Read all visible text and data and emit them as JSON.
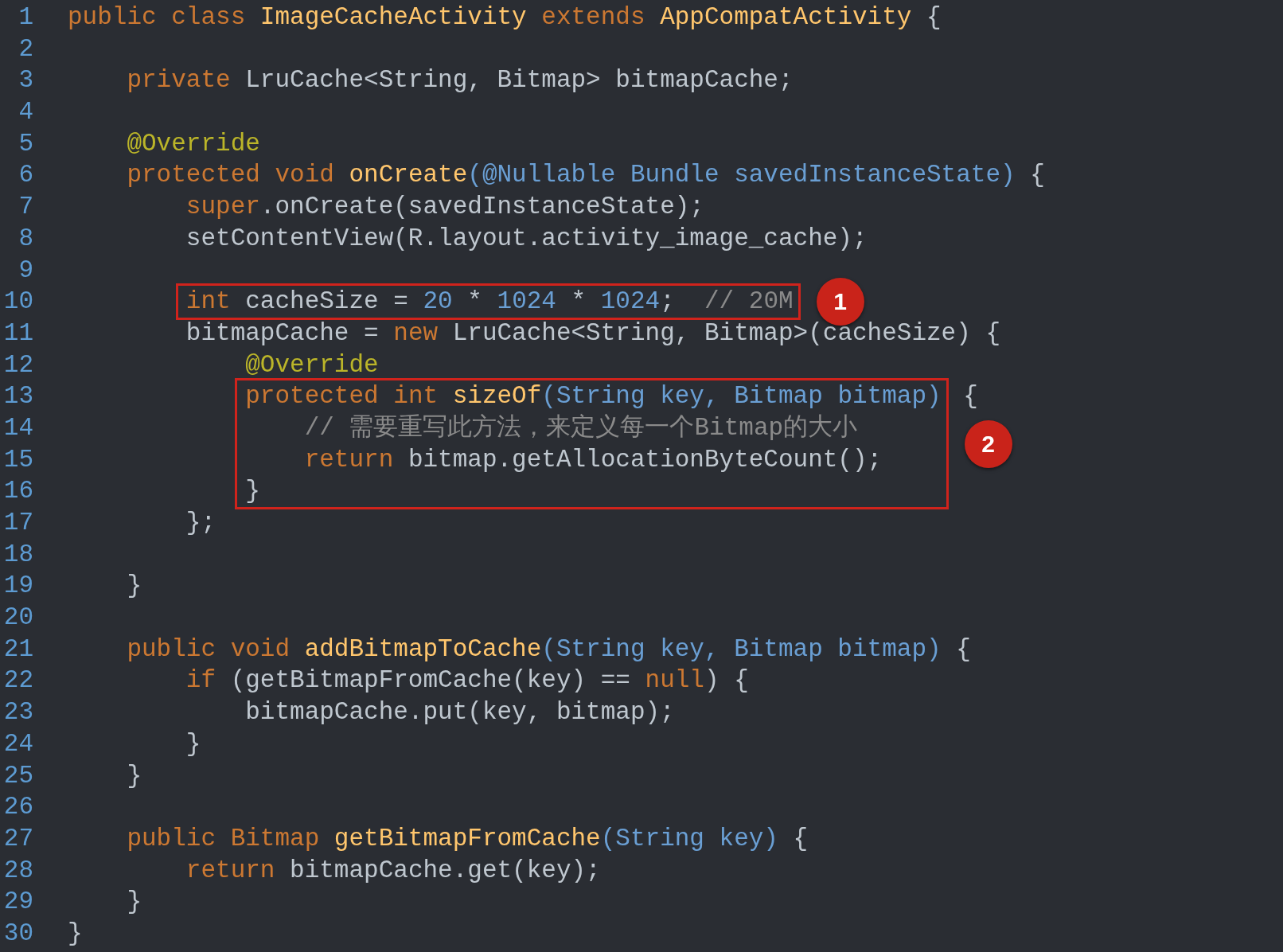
{
  "sections": [
    {
      "kind": "line",
      "number": "1",
      "tokens": [
        {
          "text": "public class ",
          "kind": "keyword"
        },
        {
          "text": "ImageCacheActivity",
          "kind": "method"
        },
        {
          "text": " extends ",
          "kind": "keyword"
        },
        {
          "text": "AppCompatActivity",
          "kind": "method"
        },
        {
          "text": " {",
          "kind": "plain"
        }
      ]
    },
    {
      "kind": "line",
      "number": "2"
    },
    {
      "kind": "line",
      "number": "3",
      "tokens": [
        {
          "text": "    private ",
          "kind": "keyword"
        },
        {
          "text": "LruCache<String, Bitmap> bitmapCache;",
          "kind": "plain"
        }
      ]
    },
    {
      "kind": "line",
      "number": "4"
    },
    {
      "kind": "line",
      "number": "5",
      "tokens": [
        {
          "text": "    @Override",
          "kind": "annotation"
        }
      ]
    },
    {
      "kind": "line",
      "number": "6",
      "tokens": [
        {
          "text": "    protected void ",
          "kind": "keyword"
        },
        {
          "text": "onCreate",
          "kind": "method"
        },
        {
          "text": "(@Nullable Bundle savedInstanceState)",
          "kind": "param"
        },
        {
          "text": " {",
          "kind": "plain"
        }
      ]
    },
    {
      "kind": "line",
      "number": "7",
      "tokens": [
        {
          "text": "        super",
          "kind": "keyword"
        },
        {
          "text": ".onCreate(savedInstanceState);",
          "kind": "plain"
        }
      ]
    },
    {
      "kind": "line",
      "number": "8",
      "tokens": [
        {
          "text": "        setContentView(R.layout.activity_image_cache);",
          "kind": "plain"
        }
      ]
    },
    {
      "kind": "line",
      "number": "9"
    },
    {
      "kind": "callout",
      "badge": "1",
      "lines": [
        {
          "number": "10",
          "tokens": [
            {
              "text": "        int ",
              "kind": "keyword"
            },
            {
              "text": "cacheSize = ",
              "kind": "plain"
            },
            {
              "text": "20",
              "kind": "number"
            },
            {
              "text": " * ",
              "kind": "plain"
            },
            {
              "text": "1024",
              "kind": "number"
            },
            {
              "text": " * ",
              "kind": "plain"
            },
            {
              "text": "1024",
              "kind": "number"
            },
            {
              "text": ";  ",
              "kind": "plain"
            },
            {
              "text": "// 20M",
              "kind": "comment"
            }
          ]
        }
      ]
    },
    {
      "kind": "line",
      "number": "11",
      "tokens": [
        {
          "text": "        bitmapCache = ",
          "kind": "plain"
        },
        {
          "text": "new",
          "kind": "keyword"
        },
        {
          "text": " LruCache<String, Bitmap>(cacheSize) {",
          "kind": "plain"
        }
      ]
    },
    {
      "kind": "line",
      "number": "12",
      "tokens": [
        {
          "text": "            @Override",
          "kind": "annotation"
        }
      ]
    },
    {
      "kind": "callout",
      "badge": "2",
      "trailing": [
        {
          "text": " {",
          "kind": "plain"
        }
      ],
      "lines": [
        {
          "number": "13",
          "tokens": [
            {
              "text": "            protected int ",
              "kind": "keyword"
            },
            {
              "text": "sizeOf",
              "kind": "method"
            },
            {
              "text": "(String key, Bitmap bitmap)",
              "kind": "param"
            }
          ]
        },
        {
          "number": "14",
          "tokens": [
            {
              "text": "                // 需要重写此方法，来定义每一个Bitmap的大小",
              "kind": "comment"
            }
          ]
        },
        {
          "number": "15",
          "tokens": [
            {
              "text": "                return",
              "kind": "keyword"
            },
            {
              "text": " bitmap.getAllocationByteCount();",
              "kind": "plain"
            }
          ]
        },
        {
          "number": "16",
          "tokens": [
            {
              "text": "            }",
              "kind": "plain"
            }
          ]
        }
      ]
    },
    {
      "kind": "line",
      "number": "17",
      "tokens": [
        {
          "text": "        };",
          "kind": "plain"
        }
      ]
    },
    {
      "kind": "line",
      "number": "18"
    },
    {
      "kind": "line",
      "number": "19",
      "tokens": [
        {
          "text": "    }",
          "kind": "plain"
        }
      ]
    },
    {
      "kind": "line",
      "number": "20"
    },
    {
      "kind": "line",
      "number": "21",
      "tokens": [
        {
          "text": "    public void ",
          "kind": "keyword"
        },
        {
          "text": "addBitmapToCache",
          "kind": "method"
        },
        {
          "text": "(String key, Bitmap bitmap)",
          "kind": "param"
        },
        {
          "text": " {",
          "kind": "plain"
        }
      ]
    },
    {
      "kind": "line",
      "number": "22",
      "tokens": [
        {
          "text": "        if",
          "kind": "keyword"
        },
        {
          "text": " (getBitmapFromCache(key) == ",
          "kind": "plain"
        },
        {
          "text": "null",
          "kind": "keyword"
        },
        {
          "text": ") {",
          "kind": "plain"
        }
      ]
    },
    {
      "kind": "line",
      "number": "23",
      "tokens": [
        {
          "text": "            bitmapCache.put(key, bitmap);",
          "kind": "plain"
        }
      ]
    },
    {
      "kind": "line",
      "number": "24",
      "tokens": [
        {
          "text": "        }",
          "kind": "plain"
        }
      ]
    },
    {
      "kind": "line",
      "number": "25",
      "tokens": [
        {
          "text": "    }",
          "kind": "plain"
        }
      ]
    },
    {
      "kind": "line",
      "number": "26"
    },
    {
      "kind": "line",
      "number": "27",
      "tokens": [
        {
          "text": "    public Bitmap ",
          "kind": "keyword"
        },
        {
          "text": "getBitmapFromCache",
          "kind": "method"
        },
        {
          "text": "(String key)",
          "kind": "param"
        },
        {
          "text": " {",
          "kind": "plain"
        }
      ]
    },
    {
      "kind": "line",
      "number": "28",
      "tokens": [
        {
          "text": "        return",
          "kind": "keyword"
        },
        {
          "text": " bitmapCache.get(key);",
          "kind": "plain"
        }
      ]
    },
    {
      "kind": "line",
      "number": "29",
      "tokens": [
        {
          "text": "    }",
          "kind": "plain"
        }
      ]
    },
    {
      "kind": "line",
      "number": "30",
      "tokens": [
        {
          "text": "}",
          "kind": "plain"
        }
      ]
    }
  ]
}
